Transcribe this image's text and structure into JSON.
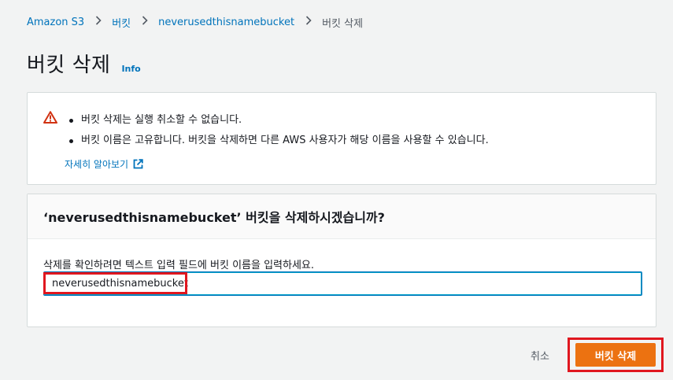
{
  "breadcrumb": {
    "items": [
      "Amazon S3",
      "버킷",
      "neverusedthisnamebucket"
    ],
    "current": "버킷 삭제"
  },
  "page": {
    "title": "버킷 삭제",
    "info_link": "Info"
  },
  "warning": {
    "icon": "warning-triangle-icon",
    "items": [
      "버킷 삭제는 실행 취소할 수 없습니다.",
      "버킷 이름은 고유합니다. 버킷을 삭제하면 다른 AWS 사용자가 해당 이름을 사용할 수 있습니다."
    ],
    "learn_more": "자세히 알아보기"
  },
  "confirm": {
    "title": "‘neverusedthisnamebucket’ 버킷을 삭제하시겠습니까?",
    "label": "삭제를 확인하려면 텍스트 입력 필드에 버킷 이름을 입력하세요.",
    "input_value": "neverusedthisnamebucket"
  },
  "actions": {
    "cancel_label": "취소",
    "delete_label": "버킷 삭제"
  },
  "colors": {
    "link": "#0073bb",
    "primary_button": "#ec7211",
    "warning": "#d13212",
    "highlight": "#e0171f"
  }
}
